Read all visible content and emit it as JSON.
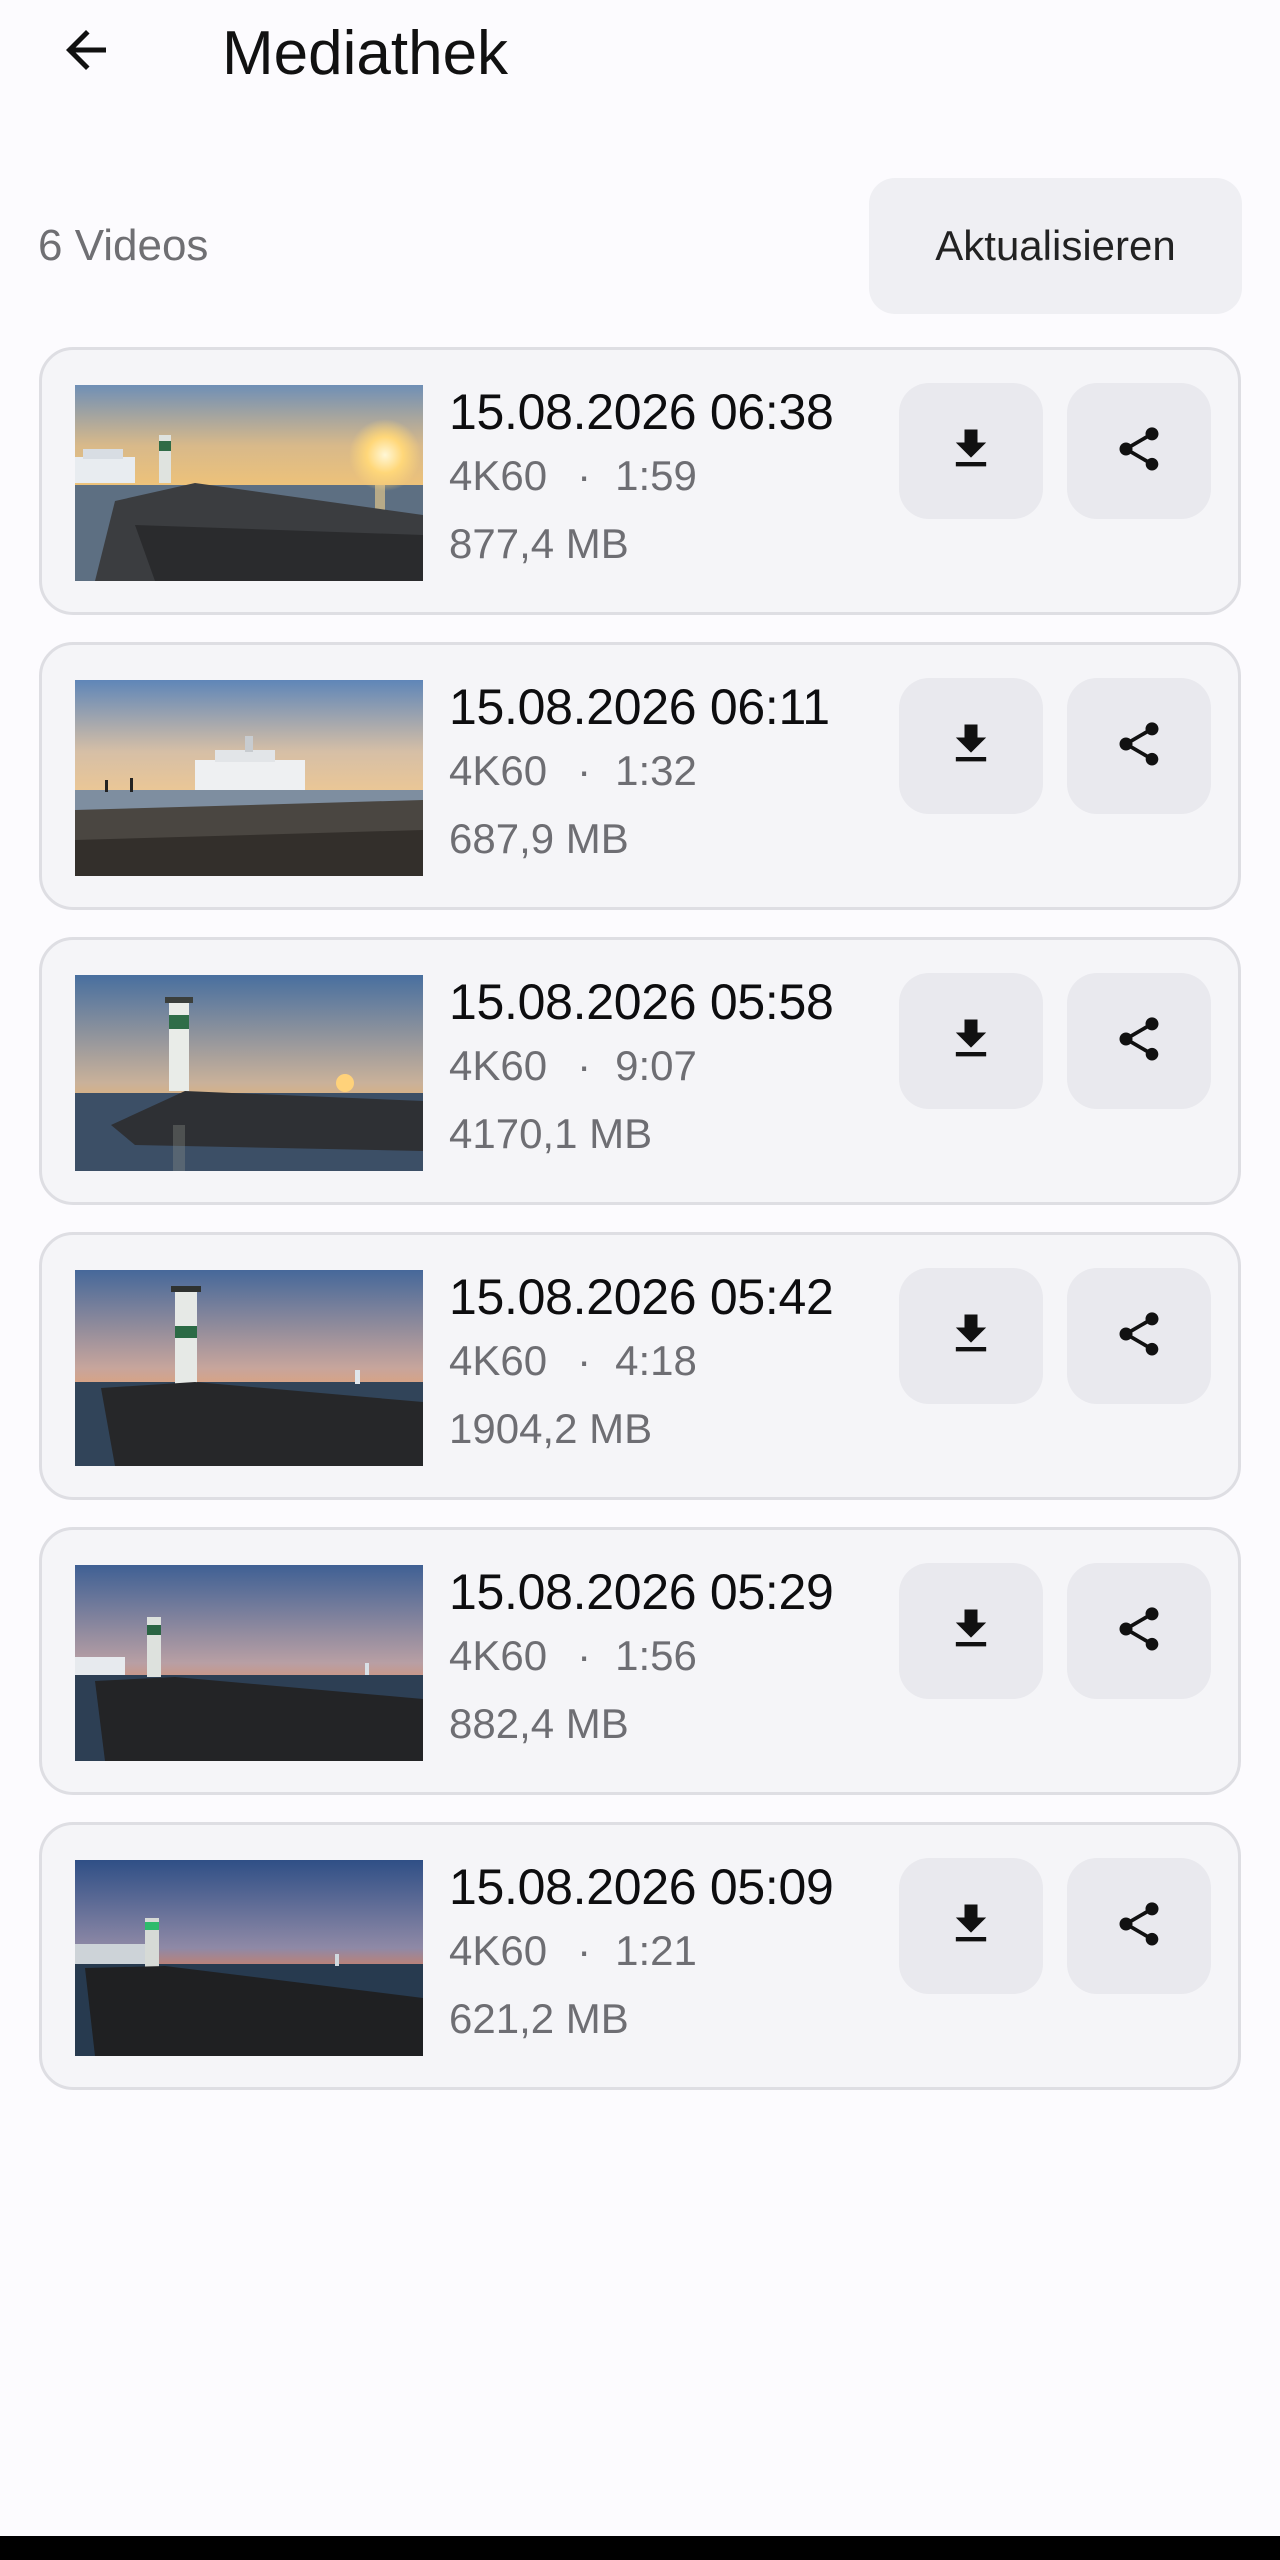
{
  "header": {
    "title": "Mediathek",
    "back_icon": "arrow-left-icon"
  },
  "toolbar": {
    "count_label": "6 Videos",
    "refresh_label": "Aktualisieren"
  },
  "icons": {
    "download": "download-icon",
    "share": "share-icon"
  },
  "videos": [
    {
      "date": "15.08.2026 06:38",
      "quality": "4K60",
      "separator": "·",
      "duration": "1:59",
      "size": "877,4 MB"
    },
    {
      "date": "15.08.2026 06:11",
      "quality": "4K60",
      "separator": "·",
      "duration": "1:32",
      "size": "687,9 MB"
    },
    {
      "date": "15.08.2026 05:58",
      "quality": "4K60",
      "separator": "·",
      "duration": "9:07",
      "size": "4170,1 MB"
    },
    {
      "date": "15.08.2026 05:42",
      "quality": "4K60",
      "separator": "·",
      "duration": "4:18",
      "size": "1904,2 MB"
    },
    {
      "date": "15.08.2026 05:29",
      "quality": "4K60",
      "separator": "·",
      "duration": "1:56",
      "size": "882,4 MB"
    },
    {
      "date": "15.08.2026 05:09",
      "quality": "4K60",
      "separator": "·",
      "duration": "1:21",
      "size": "621,2 MB"
    }
  ]
}
